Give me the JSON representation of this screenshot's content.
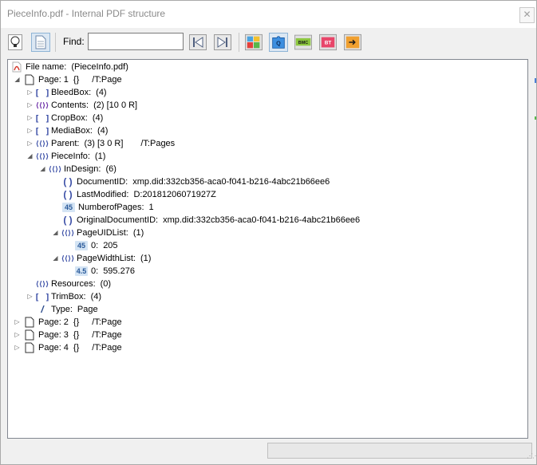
{
  "window": {
    "title": "PieceInfo.pdf - Internal PDF structure",
    "close_glyph": "✕"
  },
  "toolbar": {
    "find_label": "Find:",
    "find_value": "",
    "buttons": [
      {
        "name": "lightbulb-icon",
        "state": "normal"
      },
      {
        "name": "document-icon",
        "state": "pressed"
      },
      {
        "name": "find-previous-icon",
        "state": "normal"
      },
      {
        "name": "find-next-icon",
        "state": "normal"
      },
      {
        "name": "puzzle-blue-icon",
        "state": "normal"
      },
      {
        "name": "puzzle-q-icon",
        "state": "normal"
      },
      {
        "name": "puzzle-bmc-icon",
        "state": "normal"
      },
      {
        "name": "puzzle-bt-icon",
        "state": "normal"
      },
      {
        "name": "puzzle-arrow-icon",
        "state": "normal"
      }
    ],
    "bmc_text": "BMC",
    "bt_text": "BT",
    "q_text": "Q"
  },
  "tree": {
    "file": {
      "label": "File name:",
      "value": "(PieceInfo.pdf)"
    },
    "page1": {
      "label": "Page: 1",
      "braces": "{}",
      "type": "/T:Page"
    },
    "bleedbox": {
      "label": "BleedBox:",
      "value": "(4)"
    },
    "contents": {
      "label": "Contents:",
      "value": "(2) [10 0 R]"
    },
    "cropbox": {
      "label": "CropBox:",
      "value": "(4)"
    },
    "mediabox": {
      "label": "MediaBox:",
      "value": "(4)"
    },
    "parent": {
      "label": "Parent:",
      "value": "(3) [3 0 R]",
      "type": "/T:Pages"
    },
    "pieceinfo": {
      "label": "PieceInfo:",
      "value": "(1)"
    },
    "indesign": {
      "label": "InDesign:",
      "value": "(6)"
    },
    "documentid": {
      "label": "DocumentID:",
      "value": "xmp.did:332cb356-aca0-f041-b216-4abc21b66ee6"
    },
    "lastmodified": {
      "label": "LastModified:",
      "value": "D:20181206071927Z"
    },
    "numberofpages": {
      "label": "NumberofPages:",
      "value": "1",
      "badge": "45"
    },
    "originaldocumentid": {
      "label": "OriginalDocumentID:",
      "value": "xmp.did:332cb356-aca0-f041-b216-4abc21b66ee6"
    },
    "pageuidlist": {
      "label": "PageUIDList:",
      "value": "(1)"
    },
    "pageuid0": {
      "label": "0:",
      "value": "205",
      "badge": "45"
    },
    "pagewidthlist": {
      "label": "PageWidthList:",
      "value": "(1)"
    },
    "pagewidth0": {
      "label": "0:",
      "value": "595.276",
      "badge": "4.5"
    },
    "resources": {
      "label": "Resources:",
      "value": "(0)"
    },
    "trimbox": {
      "label": "TrimBox:",
      "value": "(4)"
    },
    "type": {
      "label": "Type:",
      "value": "Page"
    },
    "page2": {
      "label": "Page: 2",
      "braces": "{}",
      "type": "/T:Page"
    },
    "page3": {
      "label": "Page: 3",
      "braces": "{}",
      "type": "/T:Page"
    },
    "page4": {
      "label": "Page: 4",
      "braces": "{}",
      "type": "/T:Page"
    }
  },
  "icons": {
    "array": "[ ]",
    "dict": "⟨⟨⟩⟩",
    "string": "( )",
    "name": "/"
  },
  "colors": {
    "panel_border": "#828790",
    "accent": "#4b7fd6"
  }
}
